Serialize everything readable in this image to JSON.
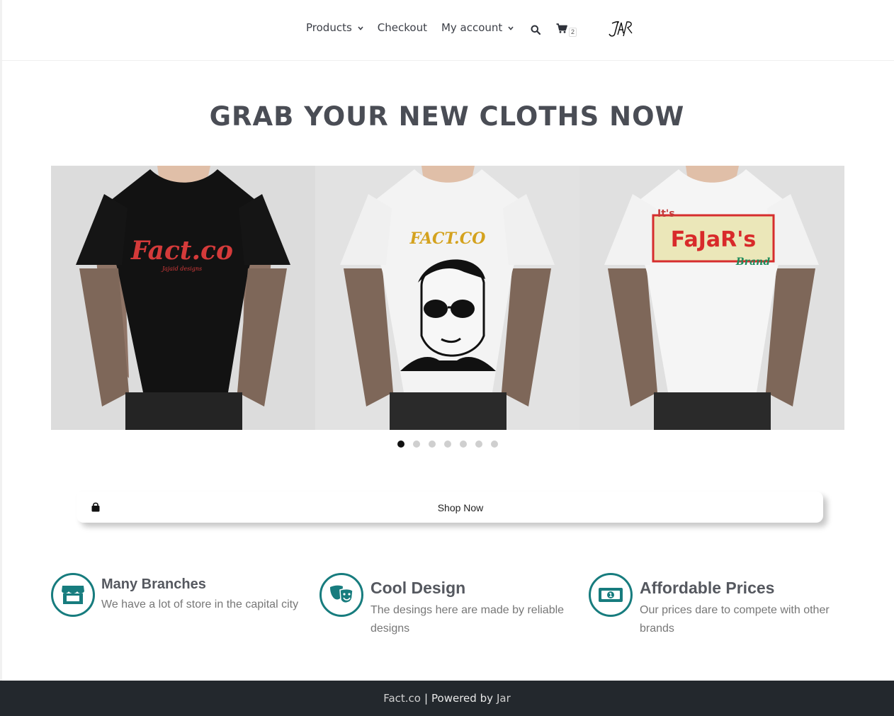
{
  "header": {
    "nav": [
      {
        "label": "Products",
        "has_dropdown": true
      },
      {
        "label": "Checkout",
        "has_dropdown": false
      },
      {
        "label": "My account",
        "has_dropdown": true
      }
    ],
    "search_icon": "search-icon",
    "cart": {
      "icon": "cart-icon",
      "count": "2"
    },
    "logo_text": "JAR"
  },
  "hero": {
    "title": "GRAB YOUR NEW CLOTHS NOW",
    "slides": [
      {
        "shirt_color": "#151515",
        "print": "Fact.co",
        "print_sub": "Jajaid designs"
      },
      {
        "shirt_color": "#f4f4f4",
        "print": "FACT.CO"
      },
      {
        "shirt_color": "#f4f4f4",
        "print": "FaJaR's",
        "print_top": "It's",
        "print_sub": "Brand"
      }
    ],
    "dots_total": 7,
    "active_dot": 1
  },
  "shop_button": {
    "label": "Shop Now",
    "icon": "shopping-bag-icon"
  },
  "features": [
    {
      "icon": "store-icon",
      "title": "Many Branches",
      "desc": "We have a lot of store in the capital city"
    },
    {
      "icon": "theater-masks-icon",
      "title": "Cool Design",
      "desc": "The desings here are made by reliable designs"
    },
    {
      "icon": "money-bill-icon",
      "title": "Affordable Prices",
      "desc": "Our prices dare to compete with other brands"
    }
  ],
  "footer": {
    "brand": "Fact.co",
    "separator": "|",
    "powered": "Powered by",
    "author": "Jar"
  },
  "colors": {
    "accent": "#177c7e",
    "footer_bg": "#23282d",
    "title": "#4a4d55"
  }
}
